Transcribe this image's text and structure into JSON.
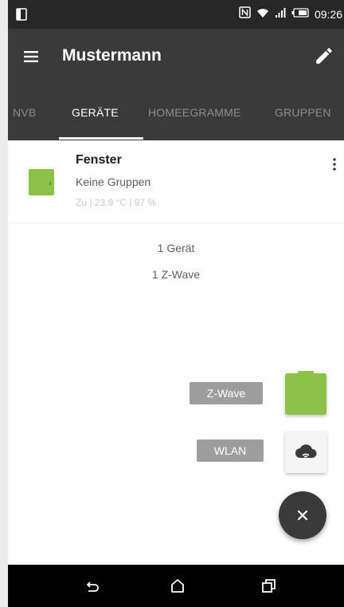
{
  "status_bar": {
    "time": "09:26",
    "icons": [
      "notification-icon",
      "nfc-icon",
      "wifi-icon",
      "signal-icon",
      "battery-icon"
    ]
  },
  "app_bar": {
    "title": "Mustermann",
    "menu_icon": "hamburger-menu-icon",
    "edit_icon": "pencil-icon"
  },
  "tabs": [
    {
      "label": "NVB",
      "active": false
    },
    {
      "label": "GERÄTE",
      "active": true
    },
    {
      "label": "HOMEEGRAMME",
      "active": false
    },
    {
      "label": "GRUPPEN",
      "active": false
    }
  ],
  "device": {
    "name": "Fenster",
    "groups": "Keine Gruppen",
    "status": "Zu | 23.9 °C | 97 %",
    "icon": "window-contact-icon",
    "icon_color": "#8bc34a",
    "more_icon": "more-vert-icon"
  },
  "summary": {
    "device_count": "1 Gerät",
    "protocol_count": "1 Z-Wave"
  },
  "speed_dial": {
    "zwave_label": "Z-Wave",
    "wlan_label": "WLAN",
    "close_icon": "close-icon"
  },
  "nav_bar": {
    "back_icon": "back-icon",
    "home_icon": "home-icon",
    "recents_icon": "recents-icon"
  },
  "colors": {
    "app_bar": "#3a3a3a",
    "status_bar": "#262626",
    "accent_green": "#8bc34a",
    "label_gray": "#9e9e9e"
  }
}
